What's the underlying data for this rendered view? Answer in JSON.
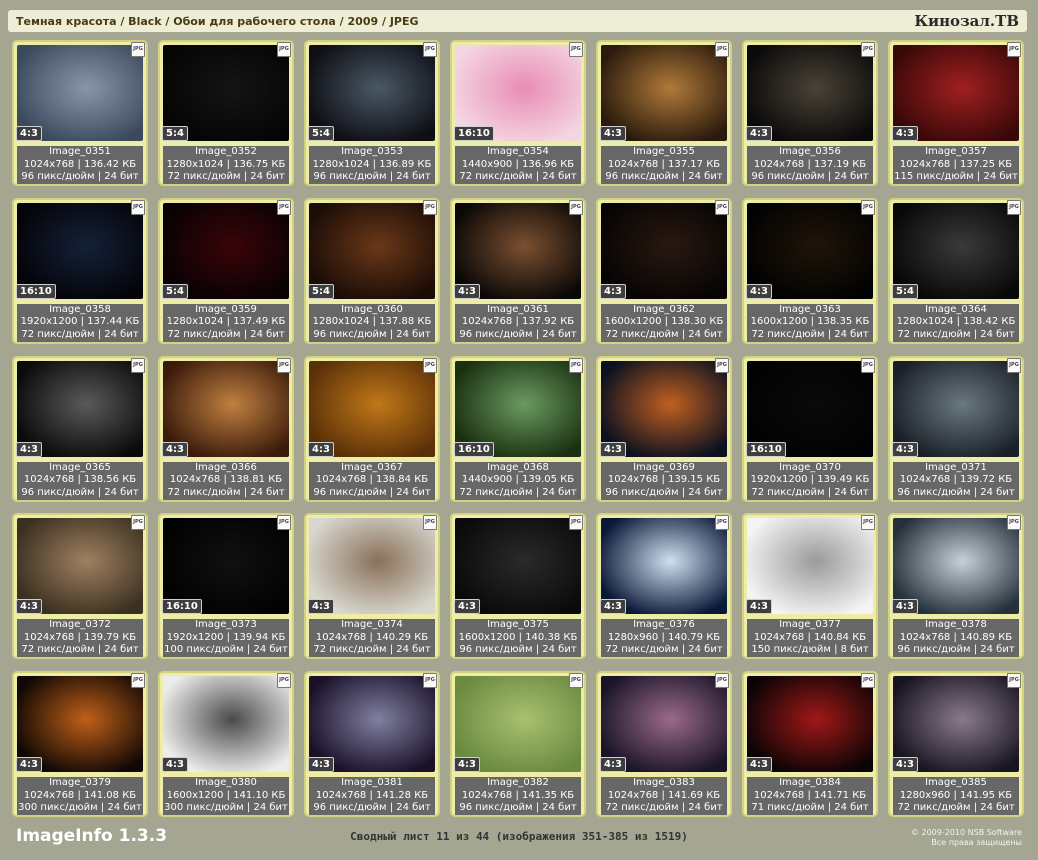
{
  "header": {
    "breadcrumb": "Темная красота / Black / Обои для рабочего стола / 2009 / JPEG",
    "logo": "Кинозал.ТВ"
  },
  "badge": "JPG",
  "tiles": [
    {
      "name": "Image_0351",
      "ratio": "4:3",
      "dims": "1024x768 | 136.42 КБ",
      "meta": "96 пикс/дюйм | 24 бит"
    },
    {
      "name": "Image_0352",
      "ratio": "5:4",
      "dims": "1280x1024 | 136.75 КБ",
      "meta": "72 пикс/дюйм | 24 бит"
    },
    {
      "name": "Image_0353",
      "ratio": "5:4",
      "dims": "1280x1024 | 136.89 КБ",
      "meta": "96 пикс/дюйм | 24 бит"
    },
    {
      "name": "Image_0354",
      "ratio": "16:10",
      "dims": "1440x900 | 136.96 КБ",
      "meta": "72 пикс/дюйм | 24 бит"
    },
    {
      "name": "Image_0355",
      "ratio": "4:3",
      "dims": "1024x768 | 137.17 КБ",
      "meta": "96 пикс/дюйм | 24 бит"
    },
    {
      "name": "Image_0356",
      "ratio": "4:3",
      "dims": "1024x768 | 137.19 КБ",
      "meta": "96 пикс/дюйм | 24 бит"
    },
    {
      "name": "Image_0357",
      "ratio": "4:3",
      "dims": "1024x768 | 137.25 КБ",
      "meta": "115 пикс/дюйм | 24 бит"
    },
    {
      "name": "Image_0358",
      "ratio": "16:10",
      "dims": "1920x1200 | 137.44 КБ",
      "meta": "72 пикс/дюйм | 24 бит"
    },
    {
      "name": "Image_0359",
      "ratio": "5:4",
      "dims": "1280x1024 | 137.49 КБ",
      "meta": "72 пикс/дюйм | 24 бит"
    },
    {
      "name": "Image_0360",
      "ratio": "5:4",
      "dims": "1280x1024 | 137.88 КБ",
      "meta": "96 пикс/дюйм | 24 бит"
    },
    {
      "name": "Image_0361",
      "ratio": "4:3",
      "dims": "1024x768 | 137.92 КБ",
      "meta": "96 пикс/дюйм | 24 бит"
    },
    {
      "name": "Image_0362",
      "ratio": "4:3",
      "dims": "1600x1200 | 138.30 КБ",
      "meta": "72 пикс/дюйм | 24 бит"
    },
    {
      "name": "Image_0363",
      "ratio": "4:3",
      "dims": "1600x1200 | 138.35 КБ",
      "meta": "72 пикс/дюйм | 24 бит"
    },
    {
      "name": "Image_0364",
      "ratio": "5:4",
      "dims": "1280x1024 | 138.42 КБ",
      "meta": "72 пикс/дюйм | 24 бит"
    },
    {
      "name": "Image_0365",
      "ratio": "4:3",
      "dims": "1024x768 | 138.56 КБ",
      "meta": "96 пикс/дюйм | 24 бит"
    },
    {
      "name": "Image_0366",
      "ratio": "4:3",
      "dims": "1024x768 | 138.81 КБ",
      "meta": "72 пикс/дюйм | 24 бит"
    },
    {
      "name": "Image_0367",
      "ratio": "4:3",
      "dims": "1024x768 | 138.84 КБ",
      "meta": "96 пикс/дюйм | 24 бит"
    },
    {
      "name": "Image_0368",
      "ratio": "16:10",
      "dims": "1440x900 | 139.05 КБ",
      "meta": "72 пикс/дюйм | 24 бит"
    },
    {
      "name": "Image_0369",
      "ratio": "4:3",
      "dims": "1024x768 | 139.15 КБ",
      "meta": "96 пикс/дюйм | 24 бит"
    },
    {
      "name": "Image_0370",
      "ratio": "16:10",
      "dims": "1920x1200 | 139.49 КБ",
      "meta": "72 пикс/дюйм | 24 бит"
    },
    {
      "name": "Image_0371",
      "ratio": "4:3",
      "dims": "1024x768 | 139.72 КБ",
      "meta": "96 пикс/дюйм | 24 бит"
    },
    {
      "name": "Image_0372",
      "ratio": "4:3",
      "dims": "1024x768 | 139.79 КБ",
      "meta": "72 пикс/дюйм | 24 бит"
    },
    {
      "name": "Image_0373",
      "ratio": "16:10",
      "dims": "1920x1200 | 139.94 КБ",
      "meta": "100 пикс/дюйм | 24 бит"
    },
    {
      "name": "Image_0374",
      "ratio": "4:3",
      "dims": "1024x768 | 140.29 КБ",
      "meta": "72 пикс/дюйм | 24 бит"
    },
    {
      "name": "Image_0375",
      "ratio": "4:3",
      "dims": "1600x1200 | 140.38 КБ",
      "meta": "96 пикс/дюйм | 24 бит"
    },
    {
      "name": "Image_0376",
      "ratio": "4:3",
      "dims": "1280x960 | 140.79 КБ",
      "meta": "72 пикс/дюйм | 24 бит"
    },
    {
      "name": "Image_0377",
      "ratio": "4:3",
      "dims": "1024x768 | 140.84 КБ",
      "meta": "150 пикс/дюйм | 8 бит"
    },
    {
      "name": "Image_0378",
      "ratio": "4:3",
      "dims": "1024x768 | 140.89 КБ",
      "meta": "96 пикс/дюйм | 24 бит"
    },
    {
      "name": "Image_0379",
      "ratio": "4:3",
      "dims": "1024x768 | 141.08 КБ",
      "meta": "300 пикс/дюйм | 24 бит"
    },
    {
      "name": "Image_0380",
      "ratio": "4:3",
      "dims": "1600x1200 | 141.10 КБ",
      "meta": "300 пикс/дюйм | 24 бит"
    },
    {
      "name": "Image_0381",
      "ratio": "4:3",
      "dims": "1024x768 | 141.28 КБ",
      "meta": "96 пикс/дюйм | 24 бит"
    },
    {
      "name": "Image_0382",
      "ratio": "4:3",
      "dims": "1024x768 | 141.35 КБ",
      "meta": "96 пикс/дюйм | 24 бит"
    },
    {
      "name": "Image_0383",
      "ratio": "4:3",
      "dims": "1024x768 | 141.69 КБ",
      "meta": "72 пикс/дюйм | 24 бит"
    },
    {
      "name": "Image_0384",
      "ratio": "4:3",
      "dims": "1024x768 | 141.71 КБ",
      "meta": "71 пикс/дюйм | 24 бит"
    },
    {
      "name": "Image_0385",
      "ratio": "4:3",
      "dims": "1280x960 | 141.95 КБ",
      "meta": "72 пикс/дюйм | 24 бит"
    }
  ],
  "thumb_colors": [
    [
      "#3a4a5c",
      "#8a96a8"
    ],
    [
      "#050505",
      "#141414"
    ],
    [
      "#0e0e14",
      "#4a5866"
    ],
    [
      "#f4d6e2",
      "#e88cb4"
    ],
    [
      "#2a1a0c",
      "#b07a3a"
    ],
    [
      "#0a0a0a",
      "#4a4236"
    ],
    [
      "#3a0808",
      "#a02020"
    ],
    [
      "#040408",
      "#142038"
    ],
    [
      "#080204",
      "#3a0408"
    ],
    [
      "#1a0c06",
      "#6a3818"
    ],
    [
      "#0a0806",
      "#7a5030"
    ],
    [
      "#060404",
      "#2a1810"
    ],
    [
      "#020202",
      "#201408"
    ],
    [
      "#080808",
      "#3a3a3a"
    ],
    [
      "#0a0a0a",
      "#5a5a5a"
    ],
    [
      "#3a1a0a",
      "#c08040"
    ],
    [
      "#5a3008",
      "#c07818"
    ],
    [
      "#1a3010",
      "#6a9a60"
    ],
    [
      "#0a1020",
      "#c06020"
    ],
    [
      "#020202",
      "#0a0a0a"
    ],
    [
      "#1a2028",
      "#6a7880"
    ],
    [
      "#3a3020",
      "#a08060"
    ],
    [
      "#020202",
      "#101010"
    ],
    [
      "#d8d8d0",
      "#8a7058"
    ],
    [
      "#0a0a0a",
      "#2a2a2a"
    ],
    [
      "#0a1838",
      "#d0e0f0"
    ],
    [
      "#f4f4f4",
      "#9a9a9a"
    ],
    [
      "#24303a",
      "#c8d0d8"
    ],
    [
      "#100804",
      "#c06018"
    ],
    [
      "#ececec",
      "#4a4a4a"
    ],
    [
      "#1a1028",
      "#8080a0"
    ],
    [
      "#6a8a40",
      "#a8c070"
    ],
    [
      "#1a1428",
      "#9a6a8a"
    ],
    [
      "#0a0404",
      "#a01818"
    ],
    [
      "#181420",
      "#8a7a8a"
    ]
  ],
  "footer": {
    "app": "ImageInfo 1.3.3",
    "summary": "Сводный лист 11 из 44 (изображения 351-385 из 1519)",
    "copyright": "© 2009-2010 NSB Software",
    "rights": "Все права защищены"
  }
}
